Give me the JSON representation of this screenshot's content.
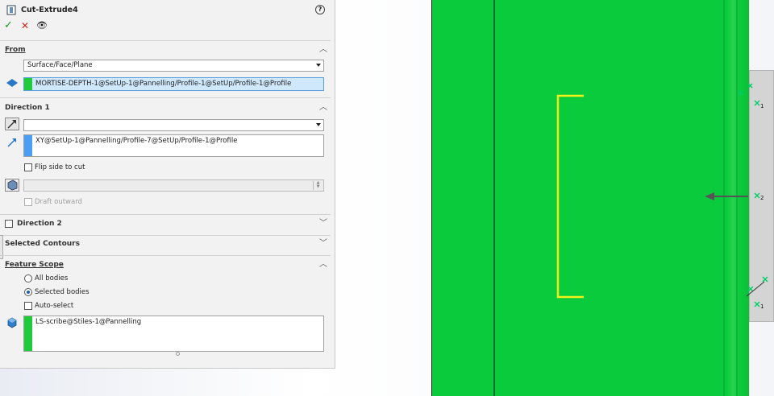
{
  "panel": {
    "title": "Cut-Extrude4",
    "help_glyph": "?",
    "ok_glyph": "✓",
    "cancel_glyph": "✕",
    "preview_glyph": "👁",
    "from": {
      "label": "From",
      "type_value": "Surface/Face/Plane",
      "entity": "MORTISE-DEPTH-1@SetUp-1@Pannelling/Profile-1@SetUp/Profile-1@Profile"
    },
    "direction1": {
      "label": "Direction 1",
      "end_condition": "",
      "direction_entity": "XY@SetUp-1@Pannelling/Profile-7@SetUp/Profile-1@Profile",
      "flip_label": "Flip side to cut",
      "draft_value": "",
      "draft_outward_label": "Draft outward"
    },
    "direction2": {
      "label": "Direction 2"
    },
    "selected_contours": {
      "label": "Selected Contours"
    },
    "feature_scope": {
      "label": "Feature Scope",
      "all_bodies": "All bodies",
      "selected_bodies": "Selected bodies",
      "auto_select": "Auto-select",
      "body": "LS-scribe@Stiles-1@Pannelling"
    }
  },
  "graphics": {
    "labels": {
      "g1": "1",
      "g2": "2",
      "g3": "1"
    }
  },
  "colors": {
    "part_green": "#0acb3c",
    "sketch_yellow": "#f2f21a",
    "field_highlight": "#cfe8fc",
    "accent_green": "#1fcb3a",
    "accent_blue": "#4a9ff5"
  }
}
